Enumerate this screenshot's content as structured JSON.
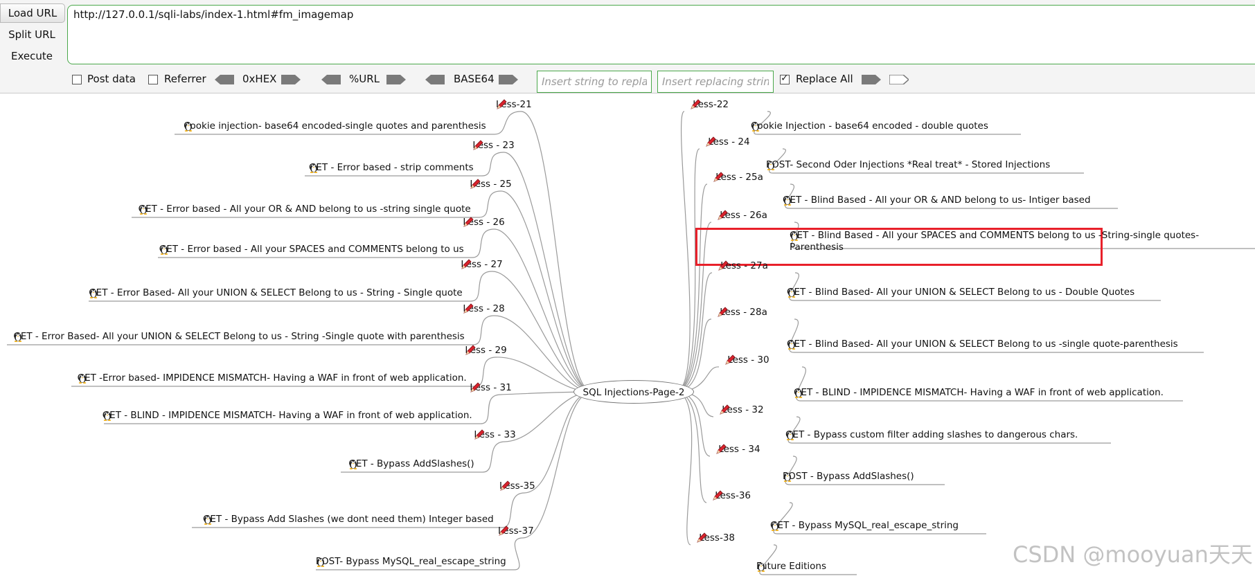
{
  "toolbar": {
    "load_url": "Load URL",
    "split_url": "Split URL",
    "execute": "Execute",
    "url_value": "http://127.0.0.1/sqli-labs/index-1.html#fm_imagemap",
    "post_data": "Post data",
    "referrer": "Referrer",
    "hex": "0xHEX",
    "url_enc": "%URL",
    "base64": "BASE64",
    "find_placeholder": "Insert string to replace",
    "replace_placeholder": "Insert replacing string",
    "replace_all": "Replace All",
    "replace_all_checked": true,
    "accent": "#4aa84a"
  },
  "mindmap": {
    "center": "SQL Injections-Page-2",
    "left": [
      {
        "less": "Less-21",
        "desc": "Cookie injection- base64 encoded-single quotes and parenthesis"
      },
      {
        "less": "Less - 23",
        "desc": "GET - Error based - strip comments"
      },
      {
        "less": "Less - 25",
        "desc": "GET - Error based - All your OR & AND belong to us -string single quote"
      },
      {
        "less": "Less - 26",
        "desc": "GET - Error based - All your SPACES and COMMENTS belong to us"
      },
      {
        "less": "Less - 27",
        "desc": "GET - Error Based- All your UNION & SELECT Belong to us - String - Single quote"
      },
      {
        "less": "Less - 28",
        "desc": "GET - Error Based- All your UNION & SELECT Belong to us - String -Single quote with parenthesis"
      },
      {
        "less": "Less - 29",
        "desc": "GET -Error based- IMPIDENCE MISMATCH- Having a WAF in front of web application."
      },
      {
        "less": "Less - 31",
        "desc": "GET - BLIND - IMPIDENCE MISMATCH- Having a WAF in front of web application."
      },
      {
        "less": "Less - 33",
        "desc": "GET - Bypass AddSlashes()"
      },
      {
        "less": "Less-35",
        "desc": "GET - Bypass Add Slashes (we dont need them) Integer based"
      },
      {
        "less": "Less-37",
        "desc": "POST- Bypass MySQL_real_escape_string"
      }
    ],
    "right": [
      {
        "less": "Less-22",
        "desc": "Cookie Injection - base64 encoded - double quotes"
      },
      {
        "less": "Less - 24",
        "desc": "POST- Second Oder Injections *Real treat* - Stored Injections"
      },
      {
        "less": "Less - 25a",
        "desc": "GET - Blind Based - All your OR & AND belong to us- Intiger based"
      },
      {
        "less": "Less - 26a",
        "desc": "GET - Blind Based - All your SPACES and COMMENTS belong to us -String-single quotes-Parenthesis"
      },
      {
        "less": "Less - 27a",
        "desc": "GET - Blind Based- All your UNION & SELECT Belong to us - Double Quotes"
      },
      {
        "less": "Less - 28a",
        "desc": "GET - Blind Based- All your UNION & SELECT Belong to us -single quote-parenthesis"
      },
      {
        "less": "Less - 30",
        "desc": "GET - BLIND - IMPIDENCE MISMATCH- Having a WAF in front of web application."
      },
      {
        "less": "Less - 32",
        "desc": "GET - Bypass custom filter adding slashes to dangerous chars."
      },
      {
        "less": "Less - 34",
        "desc": "POST - Bypass AddSlashes()"
      },
      {
        "less": "Less-36",
        "desc": "GET - Bypass MySQL_real_escape_string"
      },
      {
        "less": "Less-38",
        "desc": "Future Editions"
      }
    ],
    "highlight_color": "#e8202a"
  },
  "watermark": "CSDN @mooyuan天天"
}
